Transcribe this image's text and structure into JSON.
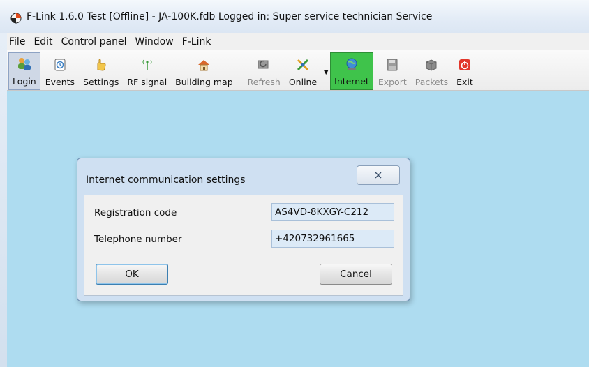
{
  "window": {
    "title": "F-Link 1.6.0 Test [Offline] - JA-100K.fdb Logged in: Super service technician Service"
  },
  "menu": [
    "File",
    "Edit",
    "Control panel",
    "Window",
    "F-Link"
  ],
  "toolbar": {
    "login": "Login",
    "events": "Events",
    "settings": "Settings",
    "rf_signal": "RF signal",
    "building_map": "Building map",
    "refresh": "Refresh",
    "online": "Online",
    "internet": "Internet",
    "export": "Export",
    "packets": "Packets",
    "exit": "Exit"
  },
  "dialog": {
    "title": "Internet communication settings",
    "registration_label": "Registration code",
    "registration_value": "AS4VD-8KXGY-C212",
    "phone_label": "Telephone number",
    "phone_value": "+420732961665",
    "ok": "OK",
    "cancel": "Cancel"
  },
  "colors": {
    "workspace": "#aedcf0",
    "internet_active": "#3fc34b",
    "dialog_frame": "#cfe0f2"
  },
  "icons": {
    "app": "f-link-app-icon",
    "close": "close-icon",
    "dropdown": "dropdown-arrow-icon"
  }
}
